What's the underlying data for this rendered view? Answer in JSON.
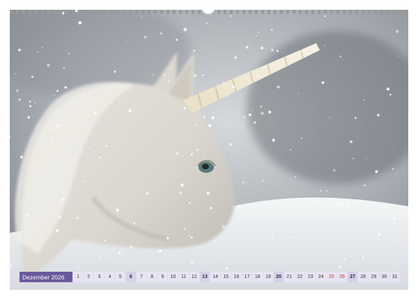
{
  "calendar": {
    "month_label": "Dezember 2026",
    "days": [
      "1",
      "2",
      "3",
      "4",
      "5",
      "6",
      "7",
      "8",
      "9",
      "10",
      "11",
      "12",
      "13",
      "14",
      "15",
      "16",
      "17",
      "18",
      "19",
      "20",
      "21",
      "22",
      "23",
      "24",
      "25",
      "26",
      "27",
      "28",
      "29",
      "30",
      "31"
    ],
    "sundays": [
      6,
      13,
      20,
      27
    ],
    "holidays": [
      25,
      26
    ],
    "colors": {
      "month_bg": "#6a5a9c",
      "day_bg": "#e8e4f2",
      "sunday_bg": "#d7d0ea",
      "holiday_text": "#c03030"
    }
  }
}
